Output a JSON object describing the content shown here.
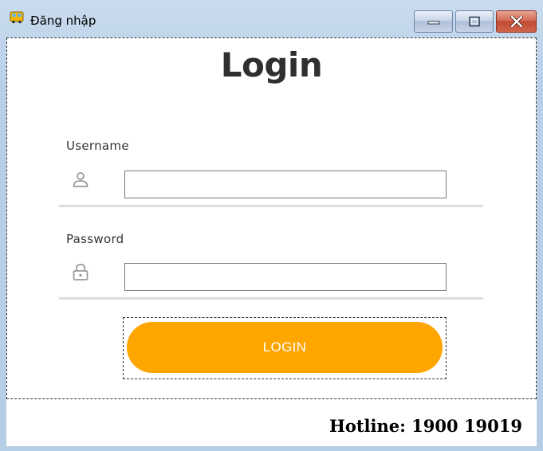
{
  "window": {
    "title": "Đăng nhập",
    "icon": "bus-icon"
  },
  "form": {
    "heading": "Login",
    "username_label": "Username",
    "username_value": "",
    "password_label": "Password",
    "password_value": "",
    "submit_label": "LOGIN"
  },
  "footer": {
    "hotline": "Hotline: 1900 19019"
  },
  "colors": {
    "accent": "#ffa500",
    "heading": "#2f2f2f",
    "divider": "#dcdcdc"
  }
}
